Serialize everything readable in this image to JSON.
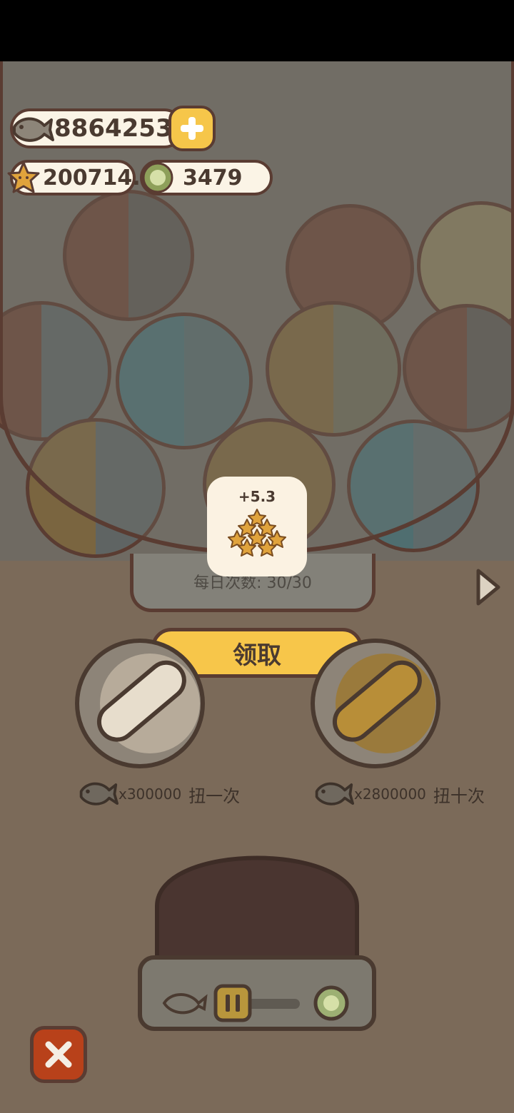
{
  "currencies": {
    "fish": "8864253",
    "stars": "200714.5",
    "coins": "3479"
  },
  "machine": {
    "daily_label": "每日次数: 30/30"
  },
  "reward_popup": {
    "amount": "+5.3",
    "icon": "star-pile-icon"
  },
  "claim_button": "领取",
  "spin_options": [
    {
      "cost": "x300000",
      "label": "扭一次",
      "icon": "fish-icon"
    },
    {
      "cost": "x2800000",
      "label": "扭十次",
      "icon": "fish-icon"
    }
  ],
  "colors": {
    "accent_yellow": "#f7c64a",
    "outline_brown": "#5a3c32",
    "close_red": "#b8411a",
    "pill_cream": "#fbf4e6"
  },
  "icons": [
    "fish-icon",
    "plus-icon",
    "star-icon",
    "coin-icon",
    "chevron-right-icon",
    "close-icon",
    "lever-icon"
  ]
}
